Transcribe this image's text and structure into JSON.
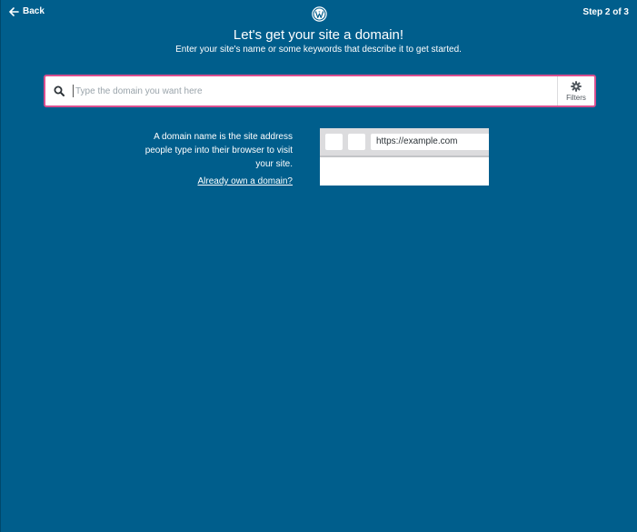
{
  "header": {
    "back_label": "Back",
    "step_label": "Step 2 of 3",
    "logo_icon": "wordpress-logo-icon"
  },
  "main": {
    "title": "Let's get your site a domain!",
    "subtitle": "Enter your site's name or some keywords that describe it to get started."
  },
  "search": {
    "placeholder": "Type the domain you want here",
    "value": "",
    "filters_label": "Filters",
    "icon": "search-icon",
    "filters_icon": "gear-icon"
  },
  "info": {
    "description": "A domain name is the site address people type into their browser to visit your site.",
    "link_label": "Already own a domain?"
  },
  "illustration": {
    "url_text": "https://example.com"
  },
  "colors": {
    "background": "#005e8c",
    "search_border": "#d94f8f",
    "text": "#ffffff"
  }
}
